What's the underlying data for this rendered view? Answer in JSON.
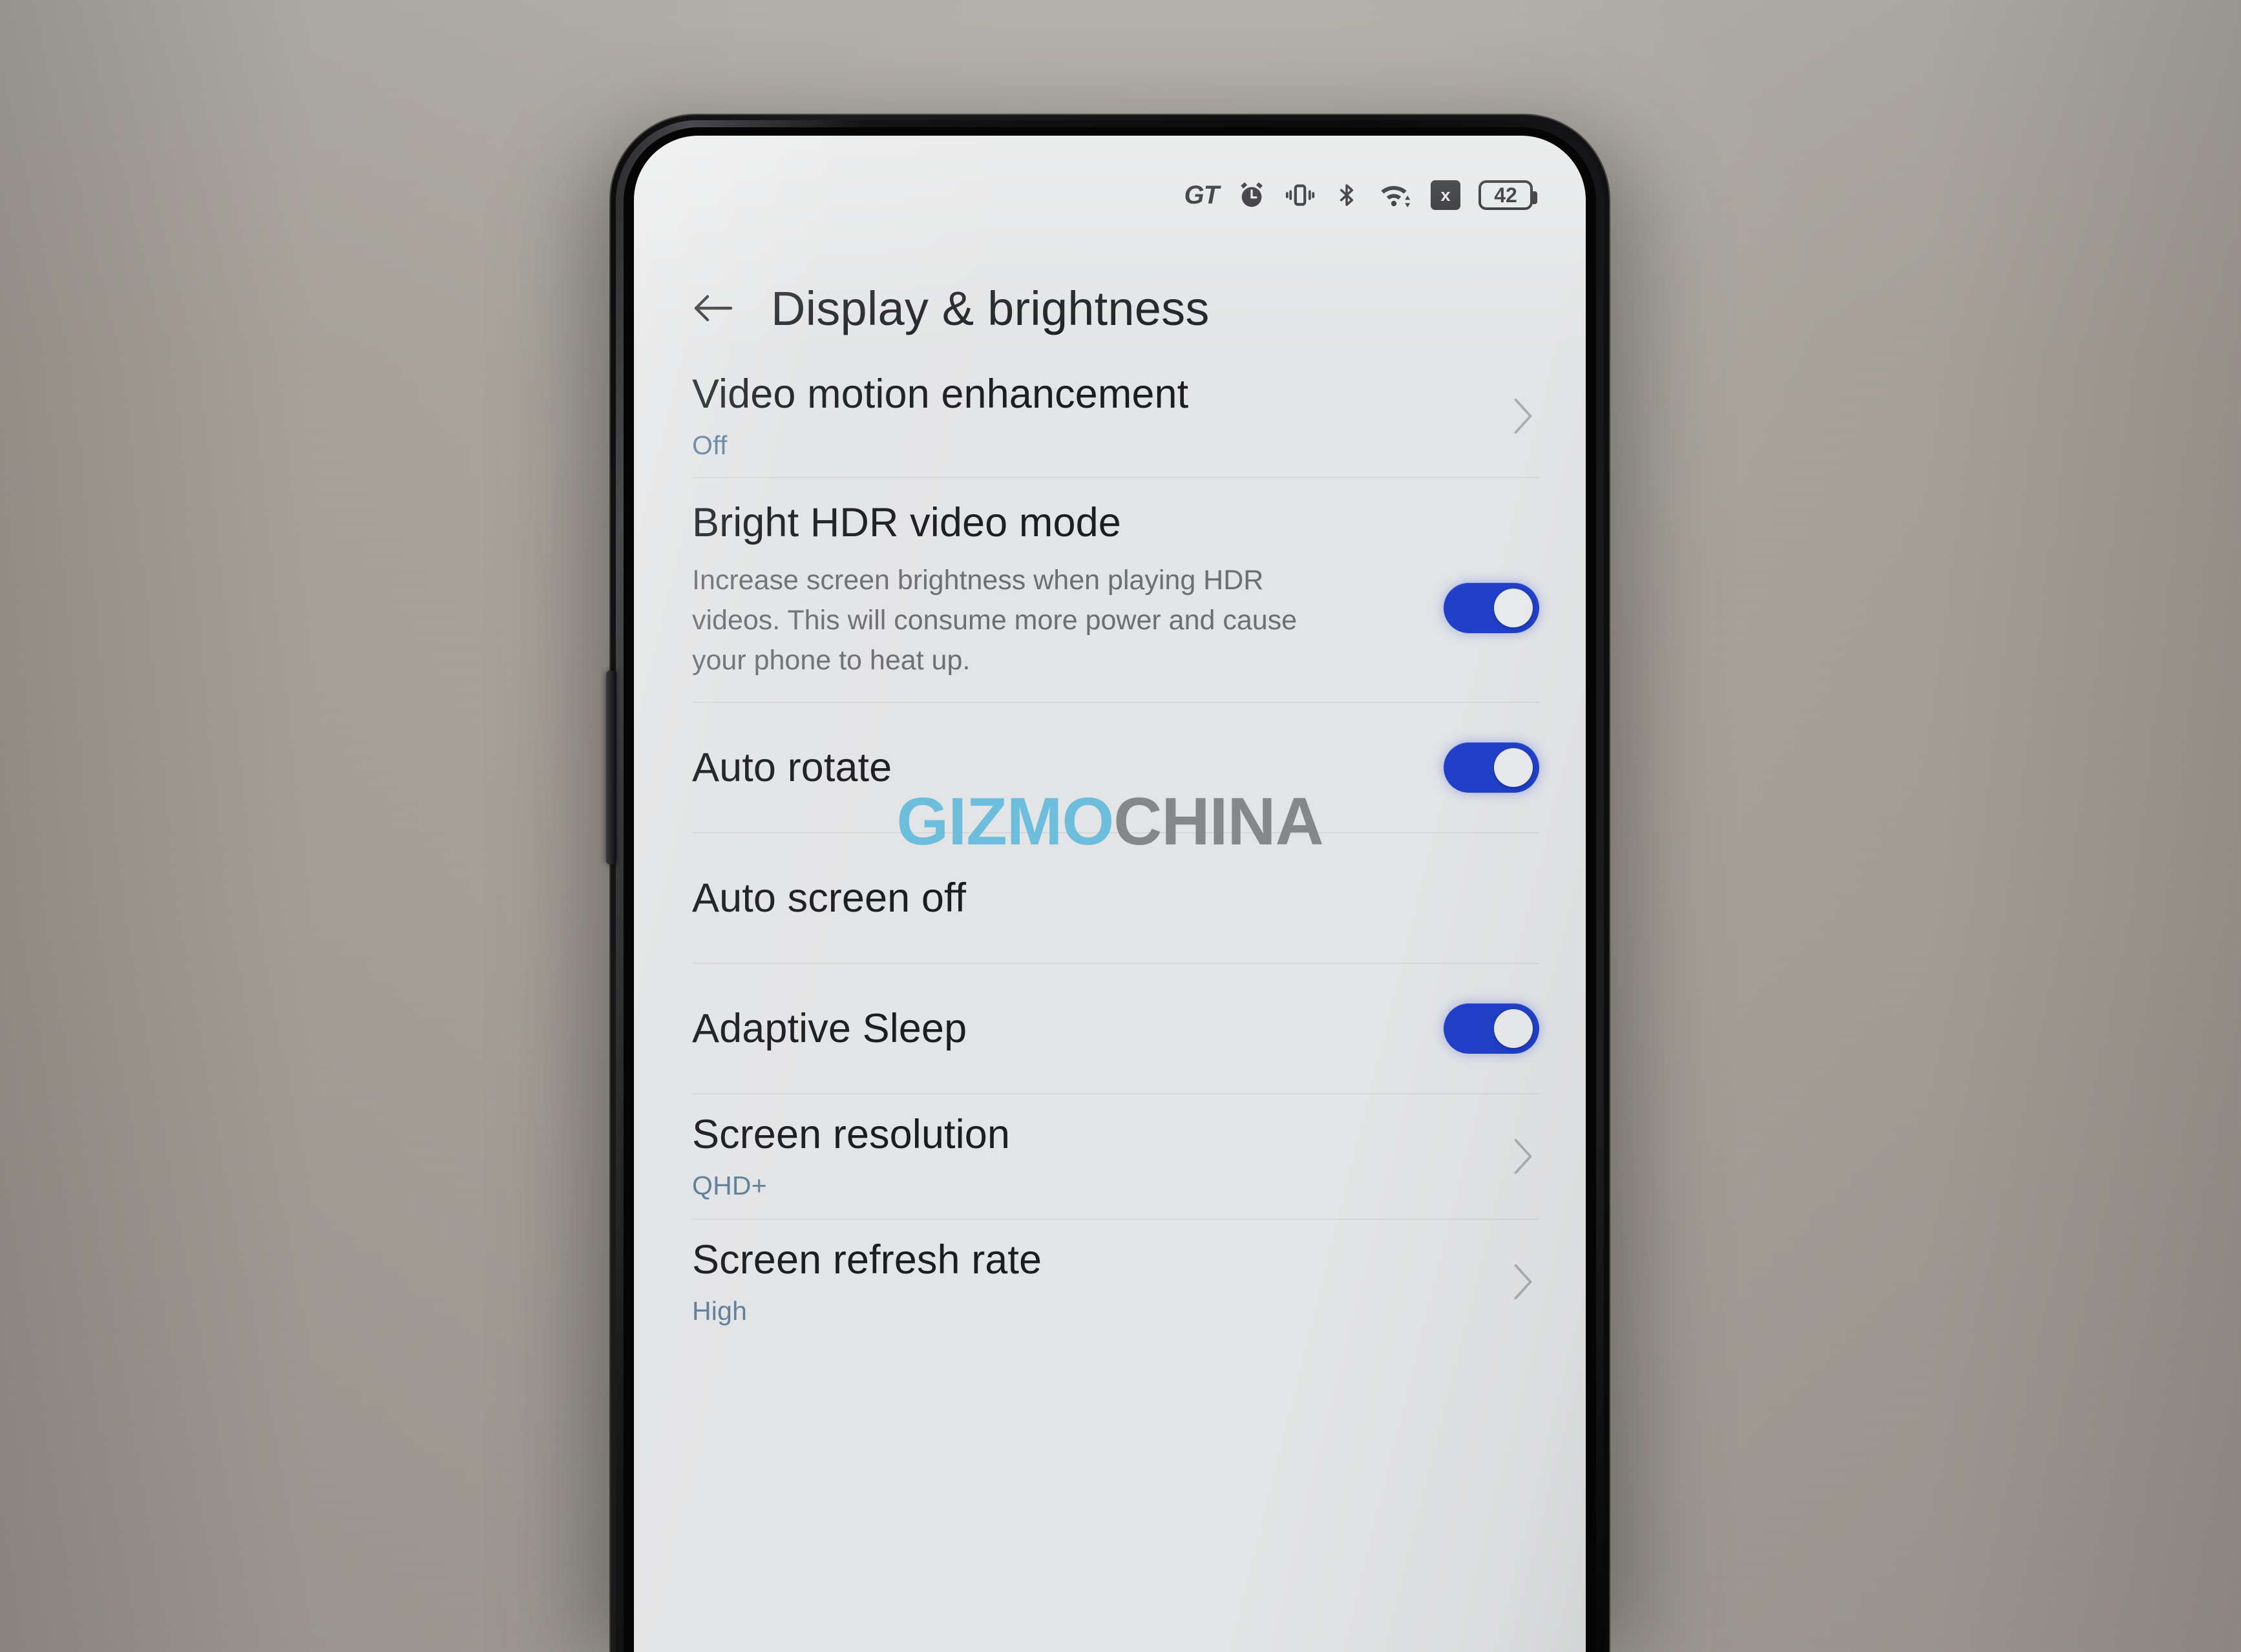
{
  "statusbar": {
    "mode_label": "GT",
    "alarm_icon": "alarm-icon",
    "vibrate_icon": "vibrate-icon",
    "bluetooth_icon": "bluetooth-icon",
    "wifi_icon": "wifi-icon",
    "no_sim_icon": "x",
    "battery_level": "42"
  },
  "header": {
    "back_icon": "back-arrow-icon",
    "title": "Display & brightness"
  },
  "watermark": {
    "part_a": "GIZMO",
    "part_b": "CHINA",
    "color_a": "#63bcdc",
    "color_b": "#7e8083"
  },
  "colors": {
    "screen_background": "#e3e4e5",
    "title_text": "#1c1d20",
    "subtitle_blue": "#5e7f9a",
    "description_text": "#6c6e72",
    "toggle_on": "#2040c8",
    "toggle_knob": "#e9eaec",
    "chevron": "#8a8c90",
    "phone_frame": "#0c0c0d",
    "desk_background": "#a9a59e"
  },
  "settings": {
    "rows": [
      {
        "title": "Video motion enhancement",
        "subtitle": "Off",
        "control": "chevron"
      },
      {
        "title": "Bright HDR video mode",
        "description": "Increase screen brightness when playing HDR videos. This will consume more power and cause your phone to heat up.",
        "control": "toggle",
        "toggle_state": "on"
      },
      {
        "title": "Auto rotate",
        "control": "toggle",
        "toggle_state": "on"
      },
      {
        "title": "Auto screen off",
        "control": "none"
      },
      {
        "title": "Adaptive Sleep",
        "control": "toggle",
        "toggle_state": "on"
      },
      {
        "title": "Screen resolution",
        "subtitle": "QHD+",
        "control": "chevron"
      },
      {
        "title": "Screen refresh rate",
        "subtitle": "High",
        "control": "chevron"
      }
    ]
  }
}
